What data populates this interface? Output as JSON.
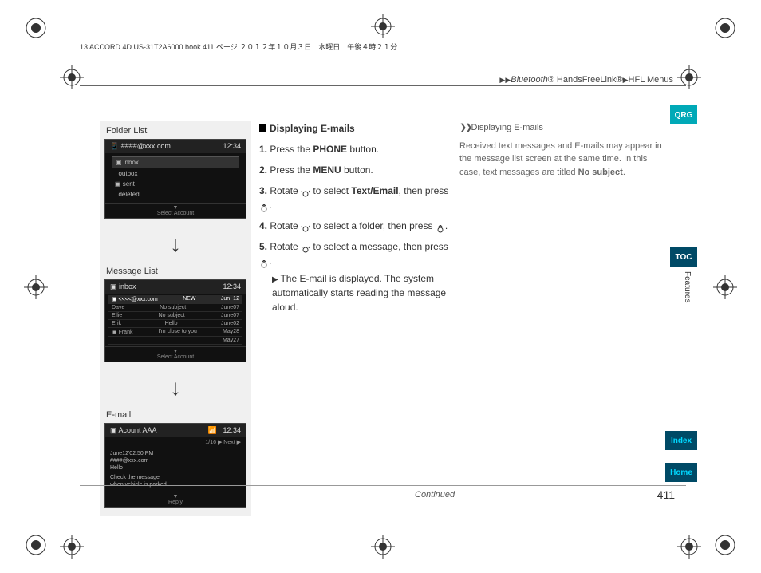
{
  "header": {
    "text": "13 ACCORD 4D US-31T2A6000.book  411 ページ  ２０１２年１０月３日　水曜日　午後４時２１分"
  },
  "crumb": {
    "bt": "Bluetooth",
    "hfl": " HandsFreeLink®",
    "menus": "HFL Menus"
  },
  "tabs": {
    "qrg": "QRG",
    "toc": "TOC",
    "features": "Features",
    "index": "Index",
    "home": "Home"
  },
  "left": {
    "folder_label": "Folder List",
    "folder_top_account": "####@xxx.com",
    "time": "12:34",
    "folders": [
      "inbox",
      "outbox",
      "sent",
      "deleted"
    ],
    "select_account": "Select Account",
    "msg_label": "Message List",
    "msg_top": "inbox",
    "msg_cols": [
      "",
      "NEW",
      "Jun~12"
    ],
    "msgs": [
      {
        "a": "Dave",
        "b": "No subject",
        "c": "June07"
      },
      {
        "a": "Ellie",
        "b": "No subject",
        "c": "June07"
      },
      {
        "a": "Erik",
        "b": "Hello",
        "c": "June02"
      },
      {
        "a": "Frank",
        "b": "I'm close to you",
        "c": "May28"
      },
      {
        "a": "",
        "b": "",
        "c": "May27"
      }
    ],
    "email_label": "E-mail",
    "email_account": "Acount AAA",
    "email_nav": "1/16    ▶    Next  ▶",
    "email_body_1": "June12'02:50 PM",
    "email_body_2": "####@xxx.com",
    "email_body_3": "Hello",
    "email_body_4": "Check the message",
    "email_body_5": "when vehicle is parked.",
    "reply": "Reply"
  },
  "mid": {
    "heading": "Displaying E-mails",
    "step1_a": " Press the ",
    "step1_b": "PHONE",
    "step1_c": " button.",
    "step2_a": " Press the ",
    "step2_b": "MENU",
    "step2_c": " button.",
    "step3_a": " Rotate ",
    "step3_b": " to select ",
    "step3_c": "Text/Email",
    "step3_d": ", then press ",
    "step3_e": ".",
    "step4_a": " Rotate ",
    "step4_b": " to select a folder, then press ",
    "step4_c": ".",
    "step5_a": " Rotate ",
    "step5_b": " to select a message, then press ",
    "step5_c": ".",
    "sub_a": "The E-mail is displayed. The system automatically starts reading the message aloud.",
    "n1": "1.",
    "n2": "2.",
    "n3": "3.",
    "n4": "4.",
    "n5": "5."
  },
  "rightnote": {
    "head": "Displaying E-mails",
    "body_a": "Received text messages and E-mails may appear in the message list screen at the same time. In this case, text messages are titled ",
    "body_b": "No subject",
    "body_c": "."
  },
  "footer": {
    "continued": "Continued",
    "page": "411"
  }
}
